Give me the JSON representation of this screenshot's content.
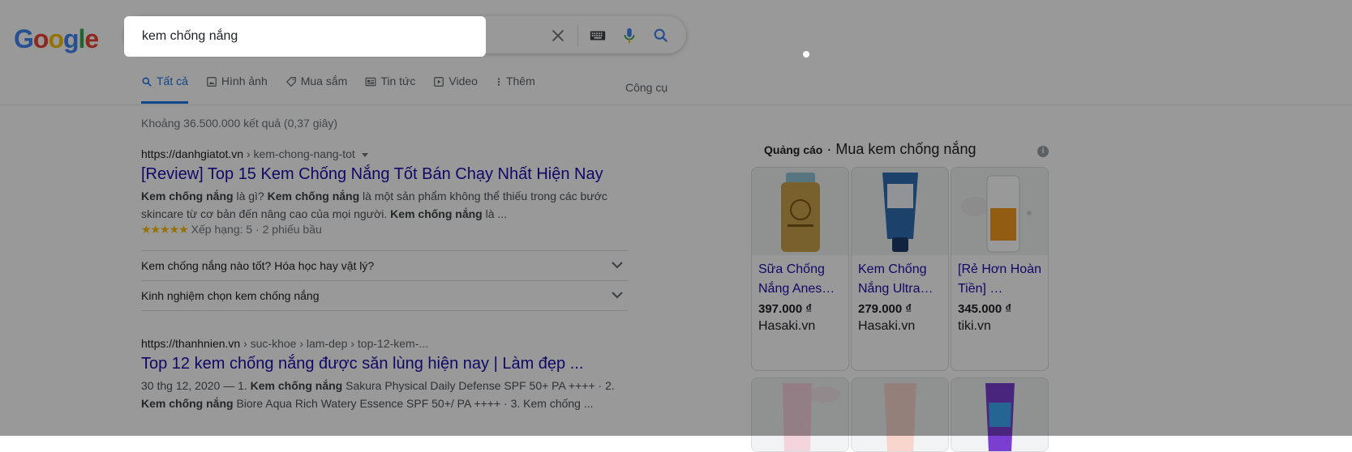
{
  "logo": {
    "letters": [
      "G",
      "o",
      "o",
      "g",
      "l",
      "e"
    ],
    "colors": [
      "#4285f4",
      "#ea4335",
      "#fbbc05",
      "#4285f4",
      "#34a853",
      "#ea4335"
    ]
  },
  "search": {
    "query": "kem chống nắng"
  },
  "tabs": [
    {
      "label": "Tất cả",
      "icon": "search-icon",
      "active": true
    },
    {
      "label": "Hình ảnh",
      "icon": "image-icon"
    },
    {
      "label": "Mua sắm",
      "icon": "tag-icon"
    },
    {
      "label": "Tin tức",
      "icon": "news-icon"
    },
    {
      "label": "Video",
      "icon": "play-icon"
    },
    {
      "label": "Thêm",
      "icon": "more-vert-icon"
    }
  ],
  "tools_label": "Công cụ",
  "stats": "Khoảng 36.500.000 kết quả (0,37 giây)",
  "results": [
    {
      "domain": "https://danhgiatot.vn",
      "path": " › kem-chong-nang-tot",
      "title": "[Review] Top 15 Kem Chống Nắng Tốt Bán Chạy Nhất Hiện Nay",
      "snippet": [
        {
          "b": "Kem chống nắng"
        },
        {
          "t": " là gì? "
        },
        {
          "b": "Kem chống nắng"
        },
        {
          "t": " là một sản phẩm không thể thiếu trong các bước skincare từ cơ bản đến nâng cao của mọi người. "
        },
        {
          "b": "Kem chống nắng"
        },
        {
          "t": " là ..."
        }
      ],
      "stars": "★★★★★",
      "rating": "Xếp hạng: 5 · 2 phiếu bầu",
      "faqs": [
        "Kem chống nắng nào tốt? Hóa học hay vật lý?",
        "Kinh nghiệm chọn kem chống nắng"
      ]
    },
    {
      "domain": "https://thanhnien.vn",
      "path": " › suc-khoe › lam-dep › top-12-kem-...",
      "title": "Top 12 kem chống nắng được săn lùng hiện nay | Làm đẹp ...",
      "snippet": [
        {
          "t": "30 thg 12, 2020 — 1. "
        },
        {
          "b": "Kem chống nắng"
        },
        {
          "t": " Sakura Physical Daily Defense SPF 50+ PA ++++ · 2. "
        },
        {
          "b": "Kem chống nắng"
        },
        {
          "t": " Biore Aqua Rich Watery Essence SPF 50+/ PA ++++ · 3. Kem chống ..."
        }
      ]
    }
  ],
  "ads": {
    "label": "Quảng cáo",
    "title": " · Mua kem chống nắng",
    "products": [
      {
        "name": "Sữa Chống Nắng Anes…",
        "price": "397.000 ₫",
        "store": "Hasaki.vn",
        "image": "gold-sunscreen-bottle"
      },
      {
        "name": "Kem Chống Nắng Ultra…",
        "price": "279.000 ₫",
        "store": "Hasaki.vn",
        "image": "blue-sunscreen-tube"
      },
      {
        "name": "[Rẻ Hơn Hoàn Tiền] …",
        "price": "345.000 ₫",
        "store": "tiki.vn",
        "image": "orange-sunscreen-bottle"
      }
    ],
    "products_row2": [
      {
        "image": "pink-sunscreen-tube"
      },
      {
        "image": "peach-sunscreen-tube"
      },
      {
        "image": "purple-sunscreen-tube"
      }
    ]
  }
}
